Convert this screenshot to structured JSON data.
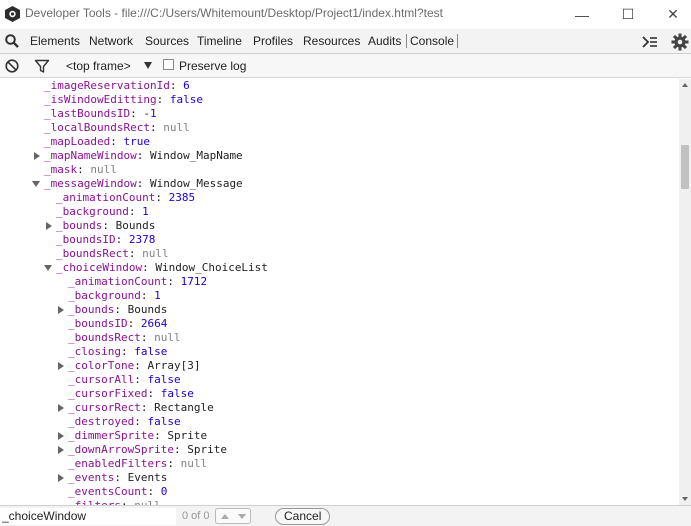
{
  "window": {
    "title": "Developer Tools - file:///C:/Users/Whitemount/Desktop/Project1/index.html?test",
    "icon": "devtools-app-icon",
    "controls": {
      "minimize": "—",
      "maximize": "☐",
      "close": "✕"
    }
  },
  "toolbar": {
    "tabs": [
      "Elements",
      "Network",
      "Sources",
      "Timeline",
      "Profiles",
      "Resources",
      "Audits",
      "Console"
    ],
    "active_tab": "Console",
    "icons": [
      "search-icon",
      "drawer-toggle-icon",
      "settings-gear-icon"
    ]
  },
  "console_toolbar": {
    "frame_selector": "<top frame>",
    "preserve_log_label": "Preserve log",
    "preserve_log_checked": false,
    "icons": [
      "clear-console-icon",
      "filter-icon"
    ]
  },
  "console": {
    "lines": [
      {
        "name": "_imageReservationId",
        "value": "6",
        "type": "num"
      },
      {
        "name": "_isWindowEditting",
        "value": "false",
        "type": "bool"
      },
      {
        "name": "_lastBoundsID",
        "value": "-1",
        "type": "num"
      },
      {
        "name": "_localBoundsRect",
        "value": "null",
        "type": "null"
      },
      {
        "name": "_mapLoaded",
        "value": "true",
        "type": "bool"
      },
      {
        "name": "_mapNameWindow",
        "value": "Window_MapName",
        "type": "obj",
        "expander": "collapsed"
      },
      {
        "name": "_mask",
        "value": "null",
        "type": "null"
      },
      {
        "name": "_messageWindow",
        "value": "Window_Message",
        "type": "obj",
        "expander": "expanded"
      },
      {
        "name": "_animationCount",
        "value": "2385",
        "type": "num"
      },
      {
        "name": "_background",
        "value": "1",
        "type": "num"
      },
      {
        "name": "_bounds",
        "value": "Bounds",
        "type": "obj",
        "expander": "collapsed"
      },
      {
        "name": "_boundsID",
        "value": "2378",
        "type": "num"
      },
      {
        "name": "_boundsRect",
        "value": "null",
        "type": "null"
      },
      {
        "name": "_choiceWindow",
        "value": "Window_ChoiceList",
        "type": "obj",
        "expander": "expanded"
      },
      {
        "name": "_animationCount",
        "value": "1712",
        "type": "num"
      },
      {
        "name": "_background",
        "value": "1",
        "type": "num"
      },
      {
        "name": "_bounds",
        "value": "Bounds",
        "type": "obj",
        "expander": "collapsed"
      },
      {
        "name": "_boundsID",
        "value": "2664",
        "type": "num"
      },
      {
        "name": "_boundsRect",
        "value": "null",
        "type": "null"
      },
      {
        "name": "_closing",
        "value": "false",
        "type": "bool"
      },
      {
        "name": "_colorTone",
        "value": "Array[3]",
        "type": "obj",
        "expander": "collapsed"
      },
      {
        "name": "_cursorAll",
        "value": "false",
        "type": "bool"
      },
      {
        "name": "_cursorFixed",
        "value": "false",
        "type": "bool"
      },
      {
        "name": "_cursorRect",
        "value": "Rectangle",
        "type": "obj",
        "expander": "collapsed"
      },
      {
        "name": "_destroyed",
        "value": "false",
        "type": "bool"
      },
      {
        "name": "_dimmerSprite",
        "value": "Sprite",
        "type": "obj",
        "expander": "collapsed"
      },
      {
        "name": "_downArrowSprite",
        "value": "Sprite",
        "type": "obj",
        "expander": "collapsed"
      },
      {
        "name": "_enabledFilters",
        "value": "null",
        "type": "null"
      },
      {
        "name": "_events",
        "value": "Events",
        "type": "obj",
        "expander": "collapsed"
      },
      {
        "name": "_eventsCount",
        "value": "0",
        "type": "num"
      },
      {
        "name": "_filters",
        "value": "null",
        "type": "null"
      }
    ]
  },
  "find_bar": {
    "query": "_choiceWindow",
    "match_count": "0 of 0",
    "cancel_label": "Cancel"
  }
}
